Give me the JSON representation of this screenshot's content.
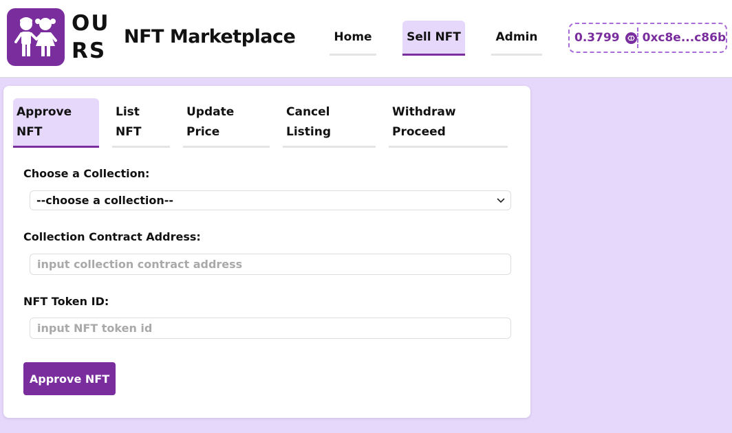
{
  "header": {
    "logo_line1": "OU",
    "logo_line2": "RS",
    "title": "NFT Marketplace",
    "nav": [
      {
        "label": "Home",
        "active": false
      },
      {
        "label": "Sell NFT",
        "active": true
      },
      {
        "label": "Admin",
        "active": false
      }
    ],
    "wallet": {
      "balance": "0.3799",
      "currency_icon": "polygon-icon",
      "address": "0xc8e...c86b"
    }
  },
  "tabs": [
    {
      "line1": "Approve",
      "line2": "NFT",
      "active": true
    },
    {
      "line1": "List",
      "line2": "NFT",
      "active": false
    },
    {
      "line1": "Update",
      "line2": "Price",
      "active": false
    },
    {
      "line1": "Cancel",
      "line2": "Listing",
      "active": false
    },
    {
      "line1": "Withdraw",
      "line2": "Proceed",
      "active": false
    }
  ],
  "form": {
    "collection_label": "Choose a Collection:",
    "collection_selected": "--choose a collection--",
    "address_label": "Collection Contract Address:",
    "address_placeholder": "input collection contract address",
    "token_label": "NFT Token ID:",
    "token_placeholder": "input NFT token id",
    "submit_label": "Approve NFT"
  },
  "colors": {
    "brand": "#7a2e9e",
    "background": "#e6d8fb"
  }
}
